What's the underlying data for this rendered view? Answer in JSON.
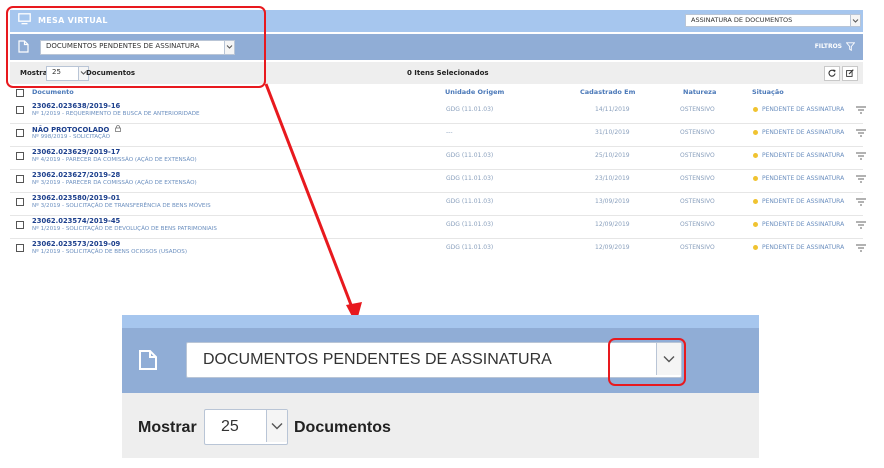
{
  "header": {
    "title": "MESA VIRTUAL",
    "top_select": "ASSINATURA DE DOCUMENTOS"
  },
  "filter_bar": {
    "status_select": "DOCUMENTOS PENDENTES DE ASSINATURA",
    "filters_label": "FILTROS"
  },
  "toolbar": {
    "show_label": "Mostrar",
    "per_page": "25",
    "docs_label": "Documentos",
    "selected_items": "0 Itens Selecionados"
  },
  "table": {
    "columns": [
      "Documento",
      "Unidade Origem",
      "Cadastrado Em",
      "Natureza",
      "Situação"
    ],
    "rows": [
      {
        "num": "23062.023638/2019-16",
        "sub": "Nº 1/2019 - REQUERIMENTO DE BUSCA DE ANTERIORIDADE",
        "unit": "GDG (11.01.03)",
        "date": "14/11/2019",
        "nature": "OSTENSIVO",
        "status": "PENDENTE DE ASSINATURA"
      },
      {
        "num": "NÃO PROTOCOLADO",
        "sub": "Nº 998/2019 - SOLICITAÇÃO",
        "unit": "---",
        "date": "31/10/2019",
        "nature": "OSTENSIVO",
        "status": "PENDENTE DE ASSINATURA"
      },
      {
        "num": "23062.023629/2019-17",
        "sub": "Nº 4/2019 - PARECER DA COMISSÃO (AÇÃO DE EXTENSÃO)",
        "unit": "GDG (11.01.03)",
        "date": "25/10/2019",
        "nature": "OSTENSIVO",
        "status": "PENDENTE DE ASSINATURA"
      },
      {
        "num": "23062.023627/2019-28",
        "sub": "Nº 3/2019 - PARECER DA COMISSÃO (AÇÃO DE EXTENSÃO)",
        "unit": "GDG (11.01.03)",
        "date": "23/10/2019",
        "nature": "OSTENSIVO",
        "status": "PENDENTE DE ASSINATURA"
      },
      {
        "num": "23062.023580/2019-01",
        "sub": "Nº 3/2019 - SOLICITAÇÃO DE TRANSFERÊNCIA DE BENS MÓVEIS",
        "unit": "GDG (11.01.03)",
        "date": "13/09/2019",
        "nature": "OSTENSIVO",
        "status": "PENDENTE DE ASSINATURA"
      },
      {
        "num": "23062.023574/2019-45",
        "sub": "Nº 1/2019 - SOLICITAÇÃO DE DEVOLUÇÃO DE BENS PATRIMONIAIS",
        "unit": "GDG (11.01.03)",
        "date": "12/09/2019",
        "nature": "OSTENSIVO",
        "status": "PENDENTE DE ASSINATURA"
      },
      {
        "num": "23062.023573/2019-09",
        "sub": "Nº 1/2019 - SOLICITAÇÃO DE BENS OCIOSOS (USADOS)",
        "unit": "GDG (11.01.03)",
        "date": "12/09/2019",
        "nature": "OSTENSIVO",
        "status": "PENDENTE DE ASSINATURA"
      }
    ]
  },
  "zoom": {
    "status_select": "DOCUMENTOS PENDENTES DE ASSINATURA",
    "show_label": "Mostrar",
    "per_page": "25",
    "docs_label": "Documentos"
  },
  "colors": {
    "header": "#a6c6ee",
    "filter_bar": "#90add6",
    "annotation": "#e8191e",
    "status_dot": "#f0c330"
  },
  "icons": {
    "monitor": "monitor-icon",
    "document": "document-icon",
    "filter": "filter-icon",
    "refresh": "refresh-icon",
    "edit": "edit-icon",
    "lock": "lock-icon",
    "row_menu": "row-menu-icon"
  }
}
